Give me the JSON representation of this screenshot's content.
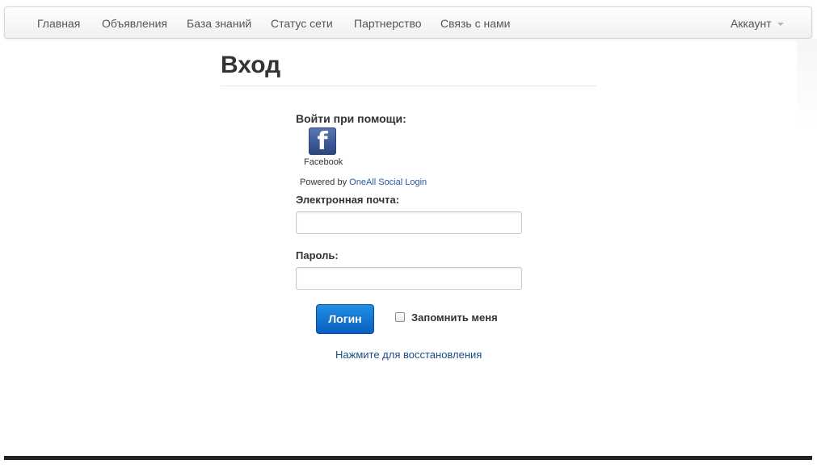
{
  "navbar": {
    "items": [
      {
        "label": "Главная"
      },
      {
        "label": "Объявления"
      },
      {
        "label": "База знаний"
      },
      {
        "label": "Статус сети"
      },
      {
        "label": "Партнерство"
      },
      {
        "label": "Связь с нами"
      }
    ],
    "account_label": "Аккаунт"
  },
  "page": {
    "title": "Вход"
  },
  "social": {
    "heading": "Войти при помощи:",
    "facebook_icon": "f",
    "facebook_label": "Facebook",
    "powered_prefix": "Powered by",
    "powered_link": "OneAll Social Login"
  },
  "form": {
    "email_label": "Электронная почта:",
    "email_value": "",
    "password_label": "Пароль:",
    "password_value": "",
    "login_button": "Логин",
    "remember_label": "Запомнить меня",
    "remember_checked": false,
    "recover_link": "Нажмите для восстановления"
  },
  "colors": {
    "primary_button": "#0a6fd6",
    "link": "#1a4c86",
    "facebook": "#3b5998"
  }
}
